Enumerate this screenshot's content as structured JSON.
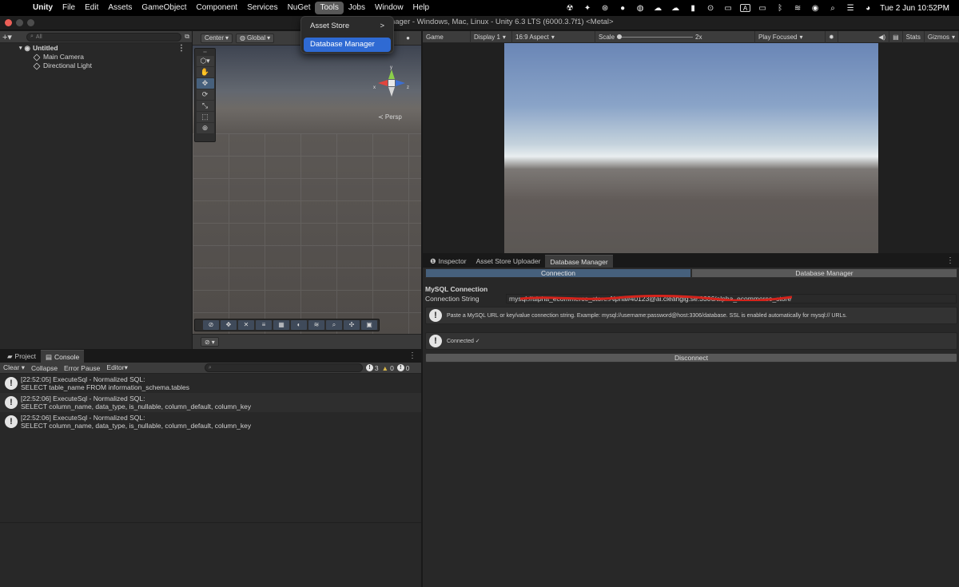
{
  "menubar": {
    "app": "Unity",
    "items": [
      "File",
      "Edit",
      "Assets",
      "GameObject",
      "Component",
      "Services",
      "NuGet",
      "Tools",
      "Jobs",
      "Window",
      "Help"
    ],
    "datetime": "Tue 2 Jun  10:52PM",
    "status_badge": "A"
  },
  "window": {
    "title": "Database Manager - Windows, Mac, Linux - Unity 6.3 LTS (6000.3.7f1) <Metal>"
  },
  "tools_menu": {
    "items": [
      {
        "label": "Asset Store",
        "submenu": ">"
      },
      {
        "label": "Database Manager"
      }
    ]
  },
  "hierarchy": {
    "add_label": "+▾",
    "search_placeholder": "All",
    "scene_name": "Untitled",
    "objects": [
      "Main Camera",
      "Directional Light"
    ]
  },
  "scene": {
    "pivot": "Center",
    "space": "Global",
    "persp_label": "≺ Persp",
    "gizmo_axes": {
      "x": "x",
      "y": "y",
      "z": "z"
    }
  },
  "game": {
    "tab": "Game",
    "display": "Display 1",
    "aspect": "16:9 Aspect",
    "scale_label": "Scale",
    "scale_value": "2x",
    "play_mode": "Play Focused",
    "stats": "Stats",
    "gizmos": "Gizmos"
  },
  "inspector": {
    "tabs": [
      "Inspector",
      "Asset Store Uploader",
      "Database Manager"
    ],
    "subtabs": [
      "Connection",
      "Database Manager"
    ],
    "section_title": "MySQL Connection",
    "connection_label": "Connection String",
    "connection_value": "mysql://alpha_ecommerce_store:Alpha#40123@ai.cleangig.se:3306/alpha_ecommerce_store",
    "help_text": "Paste a MySQL URL or key/value connection string. Example: mysql://username:password@host:3306/database. SSL is enabled automatically for mysql:// URLs.",
    "status_text": "Connected ✓",
    "disconnect_label": "Disconnect"
  },
  "console": {
    "tabs": [
      "Project",
      "Console"
    ],
    "toolbar": {
      "clear": "Clear",
      "collapse": "Collapse",
      "error_pause": "Error Pause",
      "editor": "Editor"
    },
    "counts": {
      "info": "3",
      "warning": "0",
      "error": "0"
    },
    "logs": [
      {
        "line1": "[22:52:05] ExecuteSql - Normalized SQL:",
        "line2": "SELECT table_name FROM information_schema.tables"
      },
      {
        "line1": "[22:52:06] ExecuteSql - Normalized SQL:",
        "line2": "SELECT column_name, data_type, is_nullable, column_default, column_key"
      },
      {
        "line1": "[22:52:06] ExecuteSql - Normalized SQL:",
        "line2": "SELECT column_name, data_type, is_nullable, column_default, column_key"
      }
    ]
  },
  "colors": {
    "highlight": "#2f6ad3",
    "selected_tab": "#46607c",
    "redaction": "#d4231b"
  }
}
